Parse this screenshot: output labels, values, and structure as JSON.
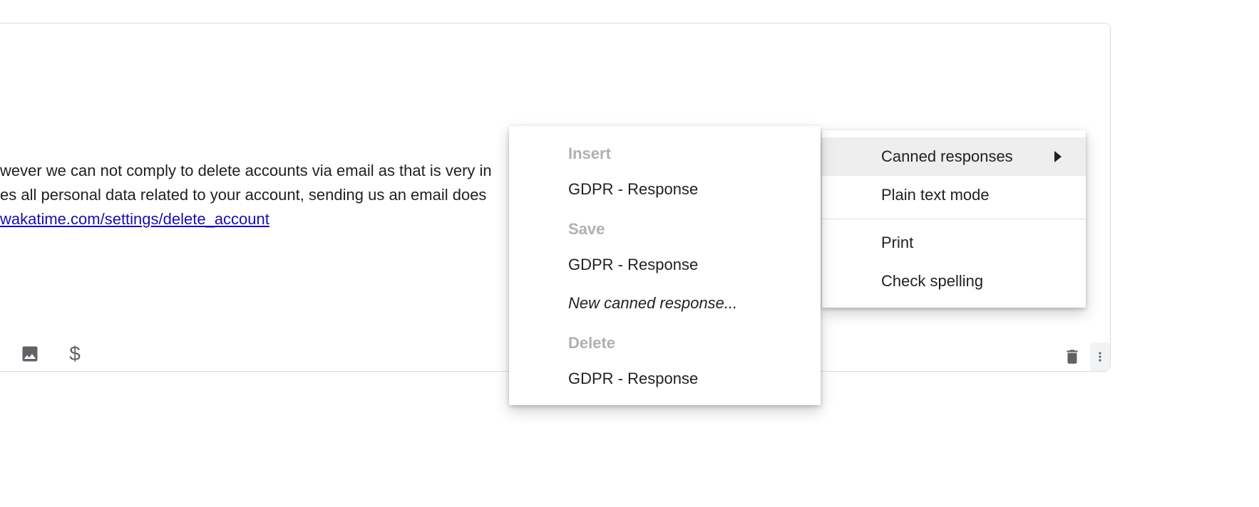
{
  "compose": {
    "body_line1": "wever we can not comply to delete accounts via email as that is very in",
    "body_line2": "es all personal data related to your account, sending us an email does",
    "link_text": "wakatime.com/settings/delete_account"
  },
  "menu_primary": {
    "canned_responses": "Canned responses",
    "plain_text": "Plain text mode",
    "print": "Print",
    "check_spelling": "Check spelling"
  },
  "menu_secondary": {
    "insert_header": "Insert",
    "insert_item1": "GDPR - Response",
    "save_header": "Save",
    "save_item1": "GDPR - Response",
    "save_item2": "New canned response...",
    "delete_header": "Delete",
    "delete_item1": "GDPR - Response"
  }
}
